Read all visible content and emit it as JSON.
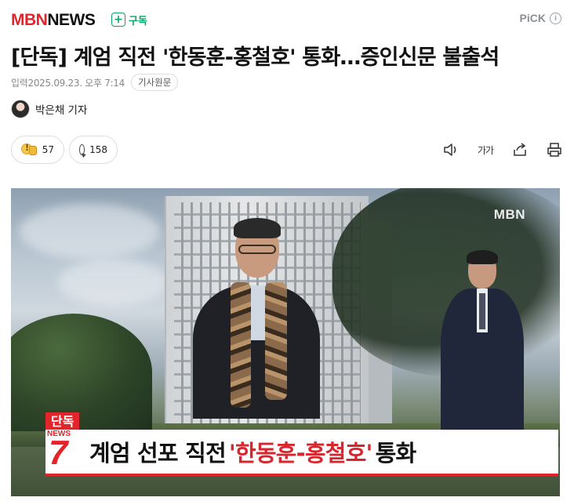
{
  "header": {
    "brand_part1": "MBN",
    "brand_part2": "NEWS",
    "subscribe_label": "구독",
    "pick_label": "PiCK",
    "info_glyph": "i"
  },
  "article": {
    "headline": "[단독] 계엄 직전 '한동훈-홍철호' 통화…증인신문 불출석",
    "published_label": "입력",
    "published_time": "2025.09.23. 오후 7:14",
    "original_link_label": "기사원문",
    "author": "박은채 기자"
  },
  "actions": {
    "reaction_count": "57",
    "comment_count": "158",
    "tools": [
      "audio-icon",
      "font-size-icon",
      "share-icon",
      "print-icon"
    ],
    "font_size_label": "가가"
  },
  "photo": {
    "channel_logo": "MBN",
    "exclusive_tag": "단독",
    "program_word": "NEWS",
    "program_number": "7",
    "caption_main": "계엄 선포 직전",
    "caption_quote": "'한동훈-홍철호'",
    "caption_tail": "통화"
  },
  "colors": {
    "brand_red": "#e4242b",
    "subscribe_green": "#0fa36b",
    "muted_text": "#888888"
  }
}
